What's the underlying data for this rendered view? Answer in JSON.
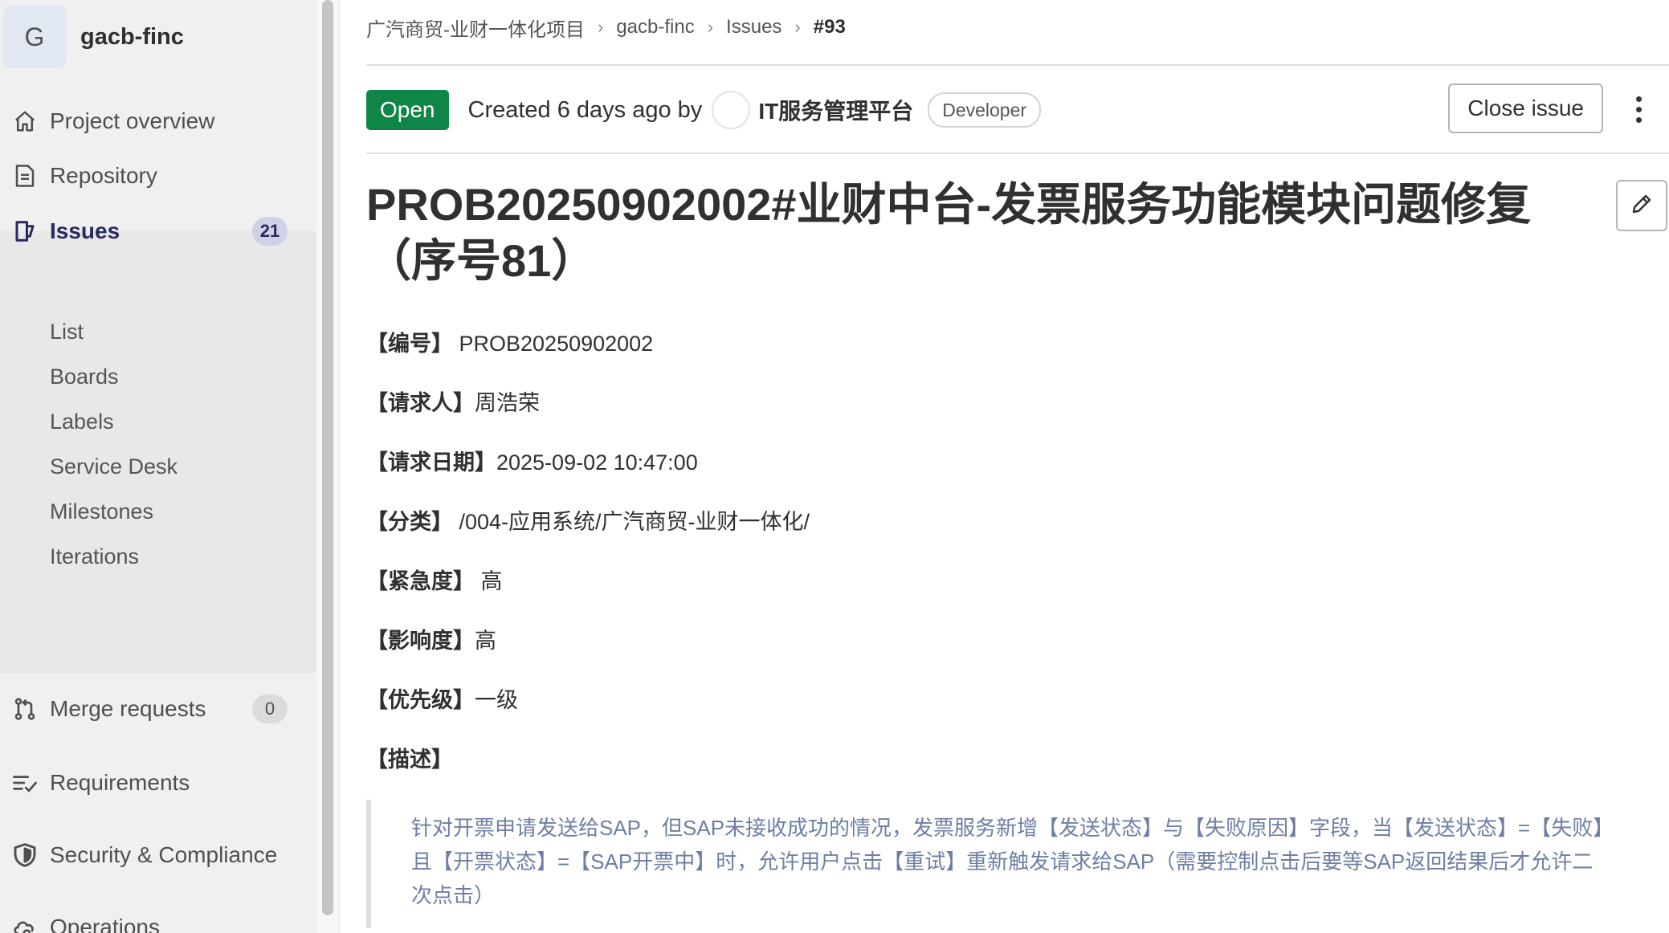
{
  "project": {
    "avatar_letter": "G",
    "name": "gacb-finc"
  },
  "sidebar": {
    "items": [
      {
        "label": "Project overview",
        "icon": "home-icon"
      },
      {
        "label": "Repository",
        "icon": "document-icon"
      },
      {
        "label": "Issues",
        "icon": "issues-icon",
        "count": "21",
        "active": true
      },
      {
        "label": "Merge requests",
        "icon": "merge-request-icon",
        "count": "0"
      },
      {
        "label": "Requirements",
        "icon": "requirements-icon"
      },
      {
        "label": "Security & Compliance",
        "icon": "shield-icon"
      },
      {
        "label": "Operations",
        "icon": "cloud-gear-icon"
      }
    ],
    "issues_sub": [
      "List",
      "Boards",
      "Labels",
      "Service Desk",
      "Milestones",
      "Iterations"
    ]
  },
  "breadcrumb": [
    "广汽商贸-业财一体化项目",
    "gacb-finc",
    "Issues",
    "#93"
  ],
  "issue": {
    "status": "Open",
    "created_text": "Created 6 days ago by",
    "author": "IT服务管理平台",
    "author_role": "Developer",
    "close_label": "Close issue",
    "title": "PROB20250902002#业财中台-发票服务功能模块问题修复（序号81）",
    "fields": [
      {
        "key": "【编号】",
        "value": " PROB20250902002"
      },
      {
        "key": "【请求人】",
        "value": "周浩荣"
      },
      {
        "key": "【请求日期】",
        "value": "2025-09-02 10:47:00"
      },
      {
        "key": "【分类】",
        "value": " /004-应用系统/广汽商贸-业财一体化/"
      },
      {
        "key": "【紧急度】",
        "value": " 高"
      },
      {
        "key": "【影响度】",
        "value": "高"
      },
      {
        "key": "【优先级】",
        "value": "一级"
      },
      {
        "key": "【描述】",
        "value": ""
      }
    ],
    "description": "针对开票申请发送给SAP，但SAP未接收成功的情况，发票服务新增【发送状态】与【失败原因】字段，当【发送状态】=【失败】且【开票状态】=【SAP开票中】时，允许用户点击【重试】重新触发请求给SAP（需要控制点击后要等SAP返回结果后才允许二次点击）"
  }
}
